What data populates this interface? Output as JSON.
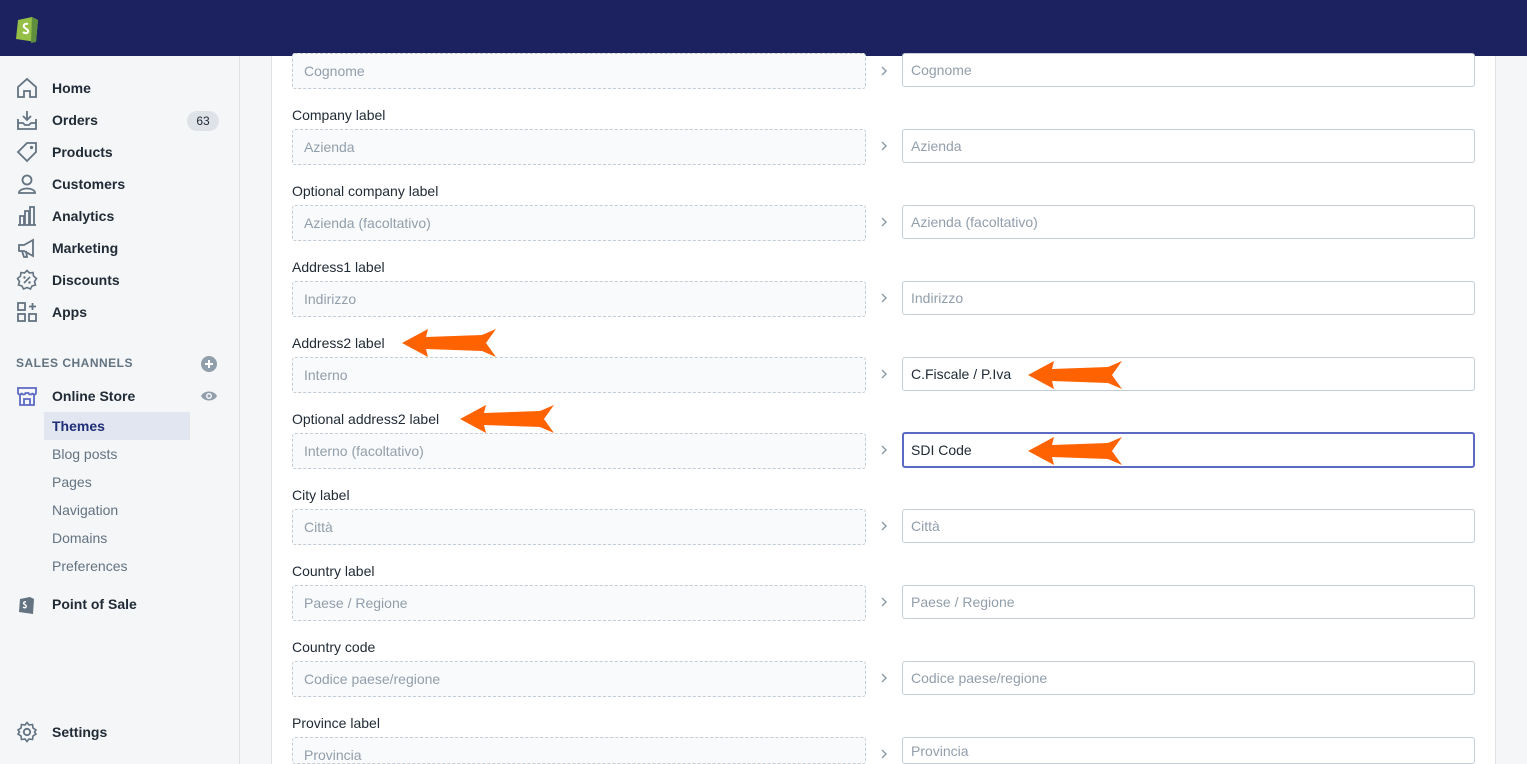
{
  "sidebar": {
    "main_items": [
      {
        "label": "Home",
        "icon": "home-icon"
      },
      {
        "label": "Orders",
        "icon": "orders-icon",
        "badge": "63"
      },
      {
        "label": "Products",
        "icon": "tag-icon"
      },
      {
        "label": "Customers",
        "icon": "person-icon"
      },
      {
        "label": "Analytics",
        "icon": "bar-chart-icon"
      },
      {
        "label": "Marketing",
        "icon": "megaphone-icon"
      },
      {
        "label": "Discounts",
        "icon": "discount-icon"
      },
      {
        "label": "Apps",
        "icon": "apps-icon"
      }
    ],
    "sales_channels_title": "SALES CHANNELS",
    "online_store_label": "Online Store",
    "sub_items": [
      "Themes",
      "Blog posts",
      "Pages",
      "Navigation",
      "Domains",
      "Preferences"
    ],
    "pos_label": "Point of Sale",
    "settings_label": "Settings"
  },
  "fields": [
    {
      "label": "",
      "default": "Cognome",
      "value": "",
      "placeholder": "Cognome"
    },
    {
      "label": "Company label",
      "default": "Azienda",
      "value": "",
      "placeholder": "Azienda"
    },
    {
      "label": "Optional company label",
      "default": "Azienda (facoltativo)",
      "value": "",
      "placeholder": "Azienda (facoltativo)"
    },
    {
      "label": "Address1 label",
      "default": "Indirizzo",
      "value": "",
      "placeholder": "Indirizzo"
    },
    {
      "label": "Address2 label",
      "default": "Interno",
      "value": "C.Fiscale / P.Iva",
      "placeholder": "Interno"
    },
    {
      "label": "Optional address2 label",
      "default": "Interno (facoltativo)",
      "value": "SDI Code",
      "placeholder": "Interno (facoltativo)"
    },
    {
      "label": "City label",
      "default": "Città",
      "value": "",
      "placeholder": "Città"
    },
    {
      "label": "Country label",
      "default": "Paese / Regione",
      "value": "",
      "placeholder": "Paese / Regione"
    },
    {
      "label": "Country code",
      "default": "Codice paese/regione",
      "value": "",
      "placeholder": "Codice paese/regione"
    },
    {
      "label": "Province label",
      "default": "Provincia",
      "value": "",
      "placeholder": "Provincia"
    }
  ],
  "colors": {
    "topbar": "#1c2260",
    "arrow": "#ff6200",
    "focus": "#5c6ac4",
    "active_nav": "#202e78"
  }
}
